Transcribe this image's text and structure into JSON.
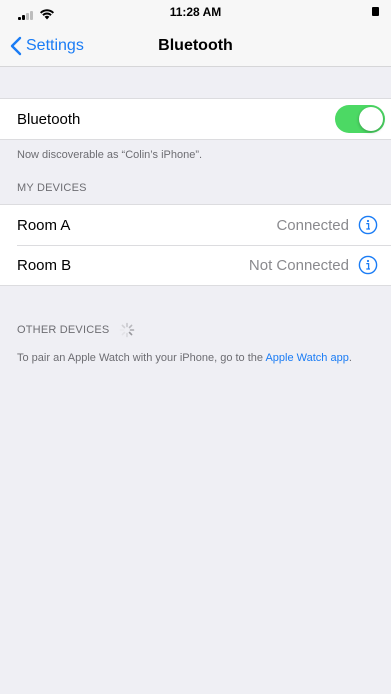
{
  "status_bar": {
    "time": "11:28 AM"
  },
  "nav": {
    "back_label": "Settings",
    "title": "Bluetooth"
  },
  "bluetooth_row": {
    "label": "Bluetooth",
    "enabled": true,
    "discoverable_note": "Now discoverable as “Colin’s iPhone”."
  },
  "my_devices": {
    "header": "MY DEVICES",
    "devices": [
      {
        "name": "Room A",
        "status": "Connected"
      },
      {
        "name": "Room B",
        "status": "Not Connected"
      }
    ]
  },
  "other_devices": {
    "header": "OTHER DEVICES",
    "note_text": "To pair an Apple Watch with your iPhone, go to the ",
    "note_link": "Apple Watch app",
    "note_end": "."
  },
  "colors": {
    "accent": "#1a7cf5",
    "toggle_on": "#4cd964",
    "background": "#efeff4",
    "secondary_text": "#8a8a8e"
  },
  "icons": {
    "back": "chevron-left-icon",
    "info": "info-circle-icon",
    "signal": "cellular-signal-icon",
    "wifi": "wifi-icon",
    "battery": "battery-icon",
    "spinner": "loading-spinner-icon"
  }
}
